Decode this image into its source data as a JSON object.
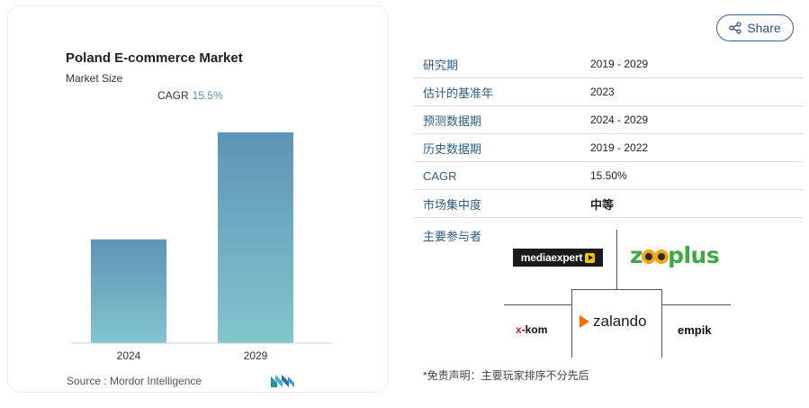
{
  "chart_card": {
    "title": "Poland E-commerce Market",
    "subtitle": "Market Size",
    "cagr_label": "CAGR",
    "cagr_value": "15.5%",
    "source": "Source :  Mordor Intelligence"
  },
  "chart_data": {
    "type": "bar",
    "categories": [
      "2024",
      "2029"
    ],
    "values": [
      1.0,
      2.03
    ],
    "colors": {
      "bar_top": "#5f93b8",
      "bar_bottom": "#82c6cc"
    }
  },
  "share": {
    "label": "Share"
  },
  "info_table": [
    {
      "key": "研究期",
      "value": "2019 - 2029",
      "bold": false
    },
    {
      "key": "估计的基准年",
      "value": "2023",
      "bold": false
    },
    {
      "key": "预测数据期",
      "value": "2024 - 2029",
      "bold": false
    },
    {
      "key": "历史数据期",
      "value": "2019 - 2022",
      "bold": false
    },
    {
      "key": "CAGR",
      "value": "15.50%",
      "bold": false
    },
    {
      "key": "市场集中度",
      "value": "中等",
      "bold": true
    }
  ],
  "players": {
    "label": "主要参与者",
    "mediaexpert": "mediaexpert",
    "zooplus_a": "z",
    "zooplus_b": "plus",
    "xkom_x": "x",
    "xkom_rest": "-kom",
    "zalando": "zalando",
    "empik": "empik"
  },
  "disclaimer": "*免责声明：主要玩家排序不分先后",
  "colors": {
    "accent": "#2e5d86",
    "cagr": "#5b8db3"
  }
}
